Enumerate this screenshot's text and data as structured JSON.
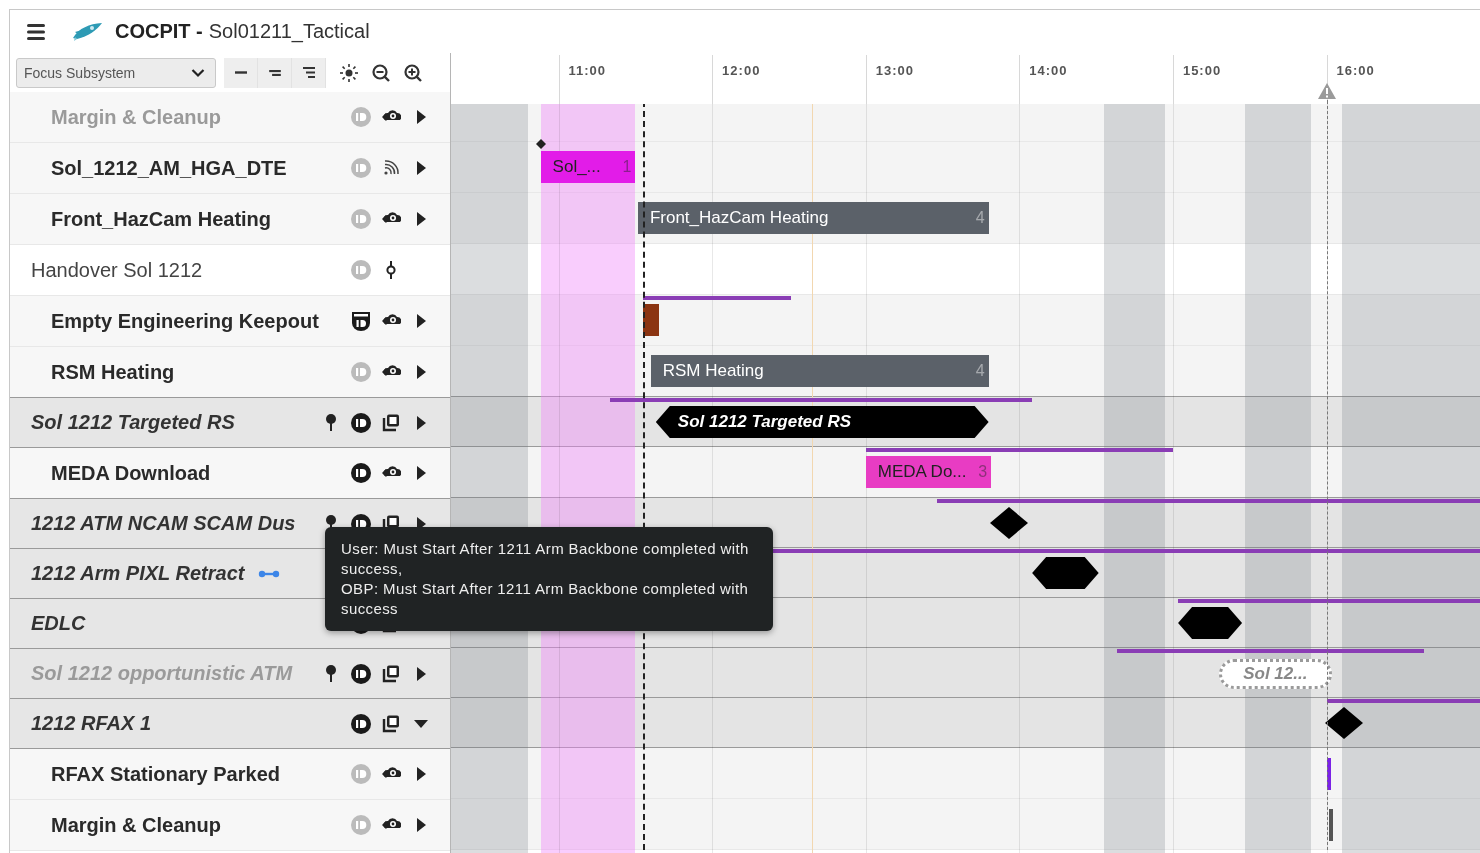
{
  "header": {
    "app_name": "COCPIT -",
    "document": "Sol01211_Tactical"
  },
  "toolbar": {
    "subsystem_dropdown": {
      "placeholder": "Focus Subsystem"
    }
  },
  "timeline": {
    "ticks": [
      "11:00",
      "12:00",
      "13:00",
      "14:00",
      "15:00",
      "16:00"
    ]
  },
  "rows": [
    {
      "kind": "activity",
      "label": "Margin & Cleanup",
      "dimmed": true,
      "id_badge": {
        "kind": "circle",
        "active": false
      },
      "type_icon": {
        "kind": "cloud"
      },
      "expanded": false
    },
    {
      "kind": "activity",
      "label": "Sol_1212_AM_HGA_DTE",
      "dimmed": false,
      "id_badge": {
        "kind": "circle",
        "active": false
      },
      "type_icon": {
        "kind": "signal"
      },
      "expanded": false,
      "items": [
        {
          "kind": "flag"
        },
        {
          "kind": "bar",
          "label": "Sol_...",
          "count": "1",
          "color": "#e21ce8"
        }
      ]
    },
    {
      "kind": "activity",
      "label": "Front_HazCam Heating",
      "dimmed": false,
      "id_badge": {
        "kind": "circle",
        "active": false
      },
      "type_icon": {
        "kind": "cloud"
      },
      "expanded": false,
      "items": [
        {
          "kind": "bar",
          "label": "Front_HazCam Heating",
          "count": "4",
          "color": "#5b6169"
        }
      ]
    },
    {
      "kind": "event",
      "label": "Handover Sol 1212",
      "dimmed": false,
      "id_badge": {
        "kind": "circle",
        "active": false
      },
      "type_icon": {
        "kind": "node"
      }
    },
    {
      "kind": "activity",
      "label": "Empty Engineering Keepout",
      "dimmed": false,
      "id_badge": {
        "kind": "shield",
        "active": true
      },
      "type_icon": {
        "kind": "cloud"
      },
      "expanded": false,
      "items": [
        {
          "kind": "line",
          "color": "#8a3db5"
        },
        {
          "kind": "bar",
          "color": "#8b3412"
        }
      ]
    },
    {
      "kind": "activity",
      "label": "RSM Heating",
      "dimmed": false,
      "id_badge": {
        "kind": "circle",
        "active": false
      },
      "type_icon": {
        "kind": "cloud"
      },
      "expanded": false,
      "items": [
        {
          "kind": "bar",
          "label": "RSM Heating",
          "count": "4",
          "color": "#5b6169"
        }
      ]
    },
    {
      "kind": "group",
      "label": "Sol 1212 Targeted RS",
      "dimmed": false,
      "pinned": true,
      "id_badge": {
        "kind": "circle",
        "active": true
      },
      "type_icon": {
        "kind": "layers"
      },
      "expanded": false,
      "items": [
        {
          "kind": "line",
          "color": "#8a3db5"
        },
        {
          "kind": "hexagon",
          "label": "Sol 1212 Targeted RS"
        }
      ]
    },
    {
      "kind": "activity",
      "label": "MEDA Download",
      "dimmed": false,
      "id_badge": {
        "kind": "circle",
        "active": true
      },
      "type_icon": {
        "kind": "cloud"
      },
      "expanded": false,
      "items": [
        {
          "kind": "line",
          "color": "#8a3db5"
        },
        {
          "kind": "bar",
          "label": "MEDA Do...",
          "count": "3",
          "color": "#e83cc3"
        }
      ]
    },
    {
      "kind": "group",
      "label": "1212 ATM NCAM SCAM Dus",
      "dimmed": false,
      "pinned": true,
      "id_badge": {
        "kind": "circle",
        "active": true
      },
      "type_icon": {
        "kind": "layers"
      },
      "expanded": false,
      "items": [
        {
          "kind": "line",
          "color": "#8a3db5"
        },
        {
          "kind": "diamond"
        }
      ]
    },
    {
      "kind": "group",
      "label": "1212 Arm PIXL Retract",
      "dimmed": false,
      "linked": true,
      "items": [
        {
          "kind": "line",
          "color": "#8a3db5"
        },
        {
          "kind": "hexagon"
        }
      ]
    },
    {
      "kind": "group",
      "label": "EDLC",
      "dimmed": false,
      "id_badge": {
        "kind": "circle",
        "active": true
      },
      "type_icon": {
        "kind": "layers"
      },
      "items": [
        {
          "kind": "line",
          "color": "#8a3db5"
        },
        {
          "kind": "hexagon"
        }
      ]
    },
    {
      "kind": "group",
      "label": "Sol 1212 opportunistic ATM",
      "dimmed": true,
      "pinned": true,
      "id_badge": {
        "kind": "circle",
        "active": true
      },
      "type_icon": {
        "kind": "layers"
      },
      "expanded": false,
      "items": [
        {
          "kind": "line",
          "color": "#8a3db5"
        },
        {
          "kind": "pill",
          "label": "Sol 12..."
        }
      ]
    },
    {
      "kind": "group",
      "label": "1212 RFAX 1",
      "dimmed": false,
      "id_badge": {
        "kind": "circle",
        "active": true
      },
      "type_icon": {
        "kind": "layers"
      },
      "expanded": true,
      "items": [
        {
          "kind": "line",
          "color": "#8a3db5"
        },
        {
          "kind": "diamond"
        }
      ],
      "children": [
        {
          "kind": "activity",
          "label": "RFAX Stationary Parked",
          "dimmed": false,
          "id_badge": {
            "kind": "circle",
            "active": false
          },
          "type_icon": {
            "kind": "cloud"
          },
          "expanded": false,
          "items": [
            {
              "kind": "tick",
              "color": "#7b22e6"
            }
          ]
        },
        {
          "kind": "activity",
          "label": "Margin & Cleanup",
          "dimmed": false,
          "id_badge": {
            "kind": "circle",
            "active": false
          },
          "type_icon": {
            "kind": "cloud"
          },
          "expanded": false,
          "items": [
            {
              "kind": "tick",
              "color": "#555555"
            }
          ]
        }
      ]
    }
  ],
  "tooltip": {
    "lines": [
      "User: Must Start After 1211 Arm Backbone completed with success,",
      "OBP: Must Start After 1211 Arm Backbone completed with success"
    ]
  }
}
